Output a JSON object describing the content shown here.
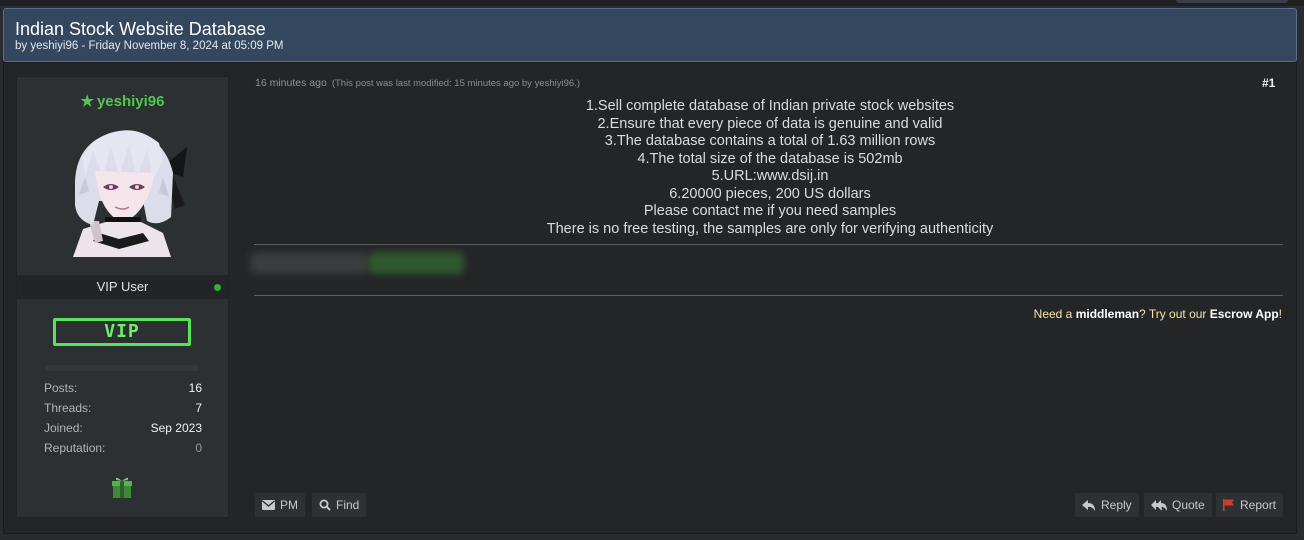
{
  "thread": {
    "title": "Indian Stock Website Database",
    "byline": "by yeshiyi96 - Friday November 8, 2024 at 05:09 PM"
  },
  "author": {
    "username": "yeshiyi96",
    "user_title": "VIP User",
    "badge": "VIP",
    "status": "online",
    "stats": [
      {
        "label": "Posts:",
        "value": "16"
      },
      {
        "label": "Threads:",
        "value": "7"
      },
      {
        "label": "Joined:",
        "value": "Sep 2023"
      },
      {
        "label": "Reputation:",
        "value": "0"
      }
    ],
    "award_icon": "gift-icon"
  },
  "post": {
    "time": "16 minutes ago",
    "modified": "(This post was last modified: 15 minutes ago by yeshiyi96.)",
    "number": "#1",
    "lines": [
      "1.Sell complete database of Indian private stock websites",
      "2.Ensure that every piece of data is genuine and valid",
      "3.The database contains a total of 1.63 million rows",
      "4.The total size of the database is 502mb",
      "5.URL:www.dsij.in",
      "6.20000 pieces, 200 US dollars",
      "Please contact me if you need samples",
      "There is no free testing, the samples are only for verifying authenticity"
    ]
  },
  "escrow": {
    "prefix": "Need a ",
    "middleman": "middleman",
    "middle": "? Try out our ",
    "app": "Escrow App",
    "suffix": "!"
  },
  "buttons": {
    "pm": "PM",
    "find": "Find",
    "reply": "Reply",
    "quote": "Quote",
    "report": "Report"
  },
  "colors": {
    "header_bg": "#33485e",
    "username": "#52c64f",
    "vip_badge": "#5ae25a",
    "report_flag": "#d33a2c"
  }
}
